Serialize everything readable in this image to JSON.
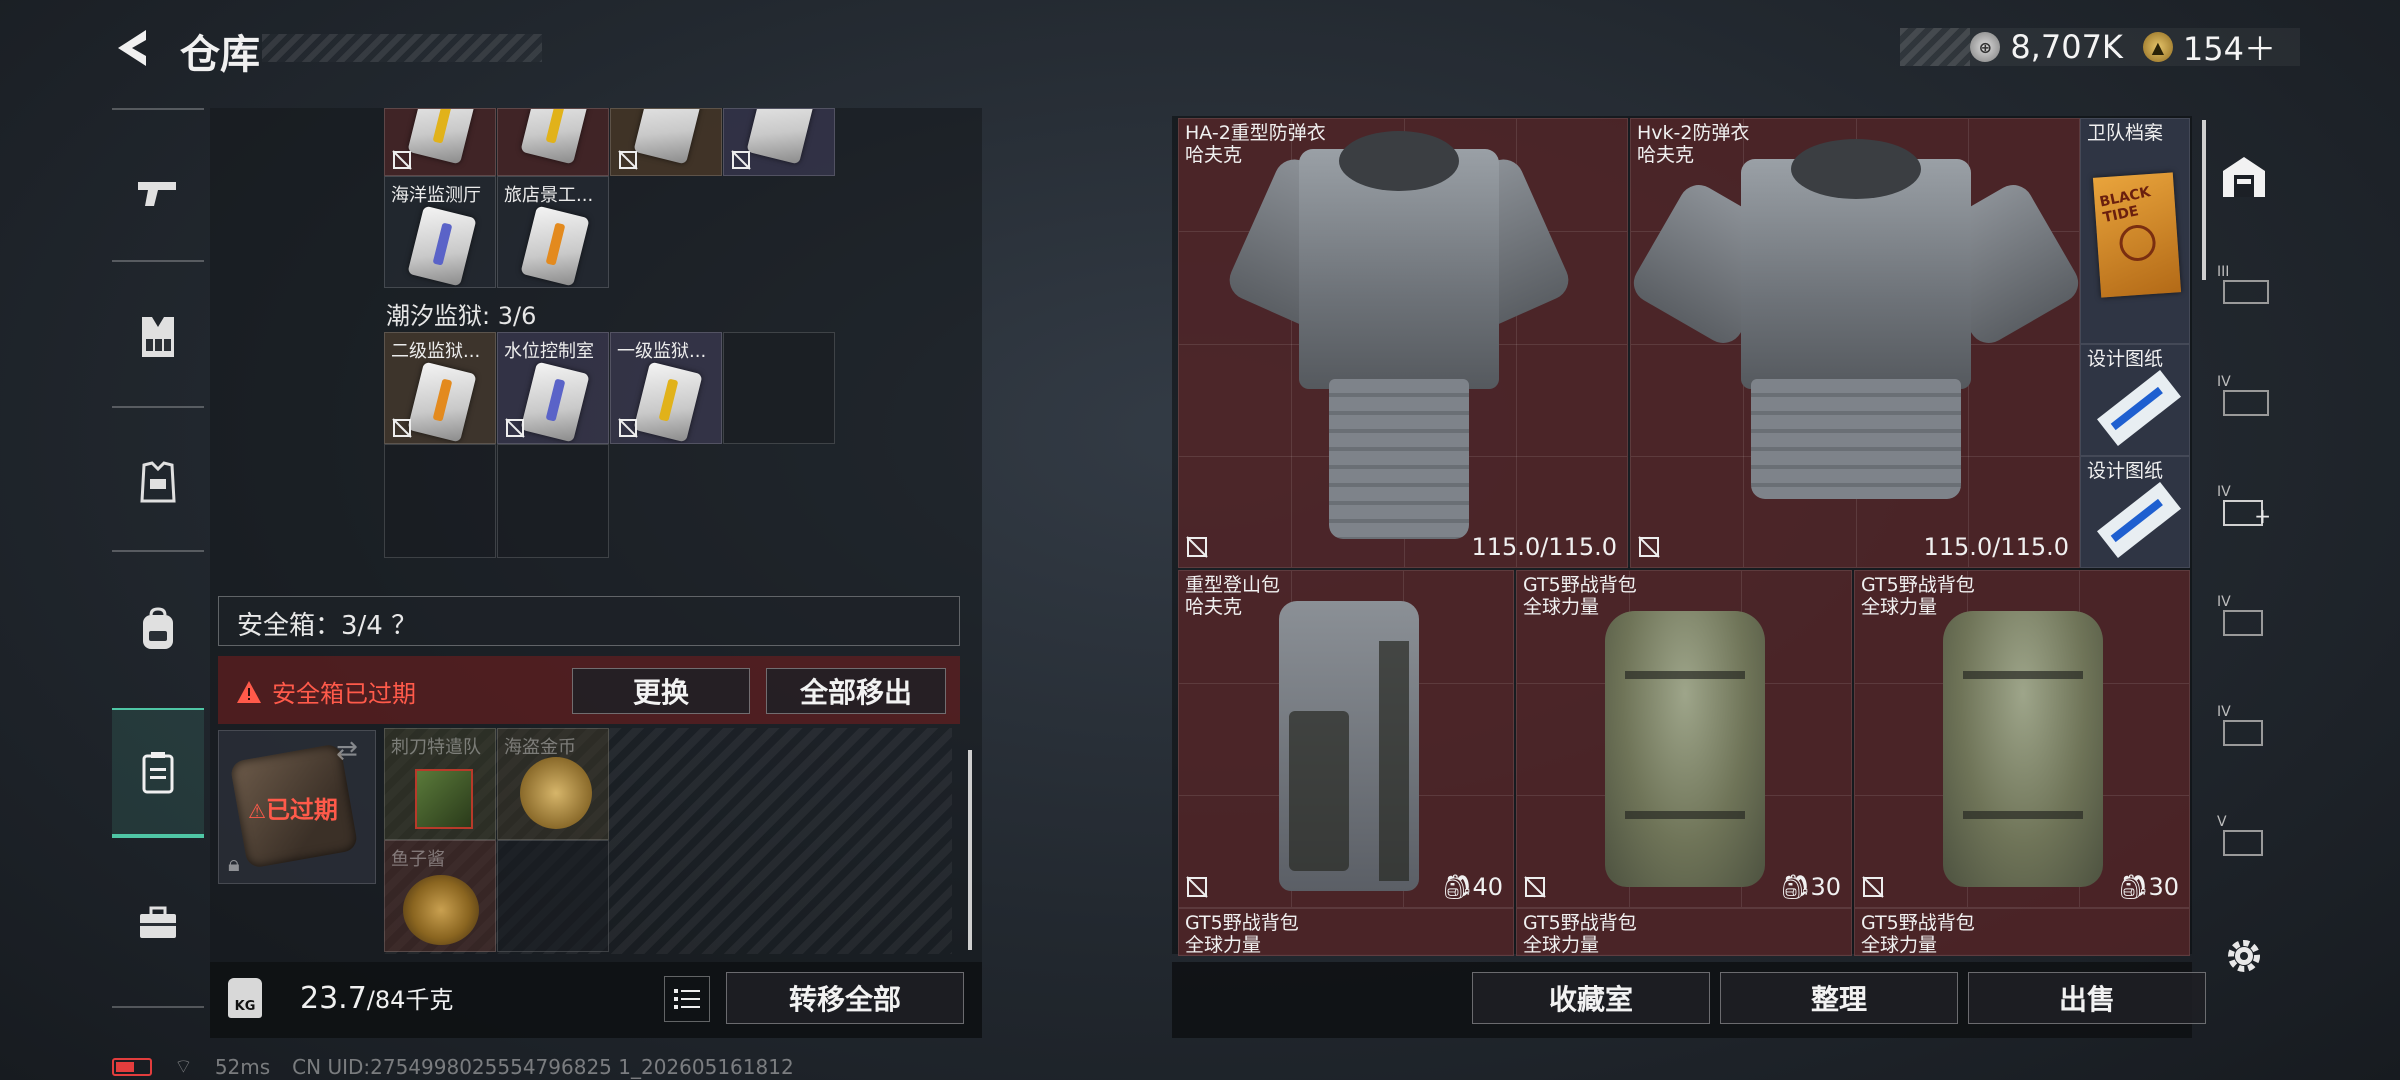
{
  "header": {
    "title": "仓库",
    "currency": [
      {
        "icon": "silver-coin-icon",
        "value": "8,707K"
      },
      {
        "icon": "gold-coin-icon",
        "value": "154＋"
      }
    ]
  },
  "left_nav": {
    "items": [
      {
        "name": "weapons",
        "icon": "pistol-icon"
      },
      {
        "name": "vests",
        "icon": "chest-rig-icon"
      },
      {
        "name": "armor",
        "icon": "armor-icon"
      },
      {
        "name": "backpacks",
        "icon": "backpack-icon"
      },
      {
        "name": "safe-box",
        "icon": "safe-box-icon",
        "active": true
      },
      {
        "name": "toolbox",
        "icon": "briefcase-icon"
      }
    ]
  },
  "keycards": {
    "top_row_labels": [
      "海洋监测厅",
      "旅店景工..."
    ],
    "section_title": "潮汐监狱: 3/6",
    "section_row_labels": [
      "二级监狱...",
      "水位控制室",
      "一级监狱..."
    ]
  },
  "safe_box": {
    "label": "安全箱：3/4 ？",
    "expired_text": "安全箱已过期",
    "replace_button": "更换",
    "remove_all_button": "全部移出",
    "case_expired": "已过期",
    "items": [
      "刺刀特遣队",
      "海盗金币",
      "鱼子酱"
    ]
  },
  "weight": {
    "icon_text": "KG",
    "current": "23.7",
    "max": "/84千克",
    "transfer_all_button": "转移全部"
  },
  "stash": {
    "items": [
      {
        "name": "HA-2重型防弹衣",
        "sub": "哈夫克",
        "value": "115.0/115.0"
      },
      {
        "name": "Hvk-2防弹衣",
        "sub": "哈夫克",
        "value": "115.0/115.0"
      },
      {
        "name": "卫队档案",
        "sub": ""
      },
      {
        "name": "设计图纸",
        "sub": ""
      },
      {
        "name": "设计图纸",
        "sub": ""
      },
      {
        "name": "重型登山包",
        "sub": "哈夫克",
        "value": "40"
      },
      {
        "name": "GT5野战背包",
        "sub": "全球力量",
        "value": "30"
      },
      {
        "name": "GT5野战背包",
        "sub": "全球力量",
        "value": "30"
      },
      {
        "name": "GT5野战背包",
        "sub": "全球力量"
      },
      {
        "name": "GT5野战背包",
        "sub": "全球力量"
      },
      {
        "name": "GT5野战背包",
        "sub": "全球力量"
      }
    ],
    "folder_text": "BLACK TIDE"
  },
  "right_actions": {
    "collection_button": "收藏室",
    "sort_button": "整理",
    "sell_button": "出售"
  },
  "right_nav": {
    "labels": [
      "III",
      "IV",
      "IV",
      "IV",
      "IV",
      "V"
    ]
  },
  "status": {
    "ping": "52ms",
    "uid": "CN UID:2754998025554796825 1_202605161812"
  }
}
